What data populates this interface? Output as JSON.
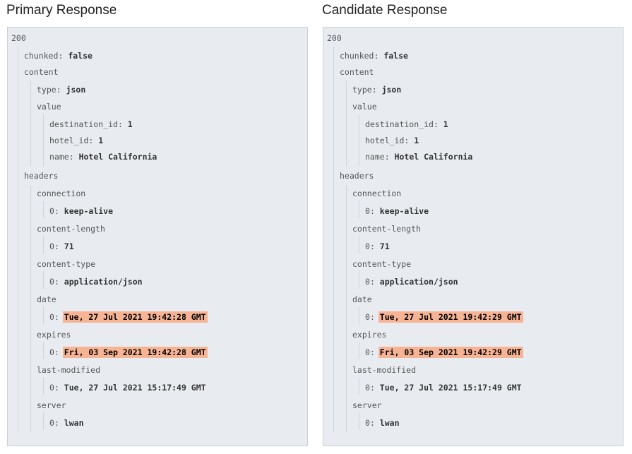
{
  "panels": [
    {
      "title": "Primary Response",
      "status": "200",
      "chunked_key": "chunked",
      "chunked_val": "false",
      "content_key": "content",
      "type_key": "type",
      "type_val": "json",
      "value_key": "value",
      "destination_id_key": "destination_id",
      "destination_id_val": "1",
      "hotel_id_key": "hotel_id",
      "hotel_id_val": "1",
      "name_key": "name",
      "name_val": "Hotel California",
      "headers_key": "headers",
      "headers": [
        {
          "key": "connection",
          "idx": "0",
          "val": "keep-alive",
          "diff": false
        },
        {
          "key": "content-length",
          "idx": "0",
          "val": "71",
          "diff": false
        },
        {
          "key": "content-type",
          "idx": "0",
          "val": "application/json",
          "diff": false
        },
        {
          "key": "date",
          "idx": "0",
          "val": "Tue, 27 Jul 2021 19:42:28 GMT",
          "diff": true
        },
        {
          "key": "expires",
          "idx": "0",
          "val": "Fri, 03 Sep 2021 19:42:28 GMT",
          "diff": true
        },
        {
          "key": "last-modified",
          "idx": "0",
          "val": "Tue, 27 Jul 2021 15:17:49 GMT",
          "diff": false
        },
        {
          "key": "server",
          "idx": "0",
          "val": "lwan",
          "diff": false
        }
      ]
    },
    {
      "title": "Candidate Response",
      "status": "200",
      "chunked_key": "chunked",
      "chunked_val": "false",
      "content_key": "content",
      "type_key": "type",
      "type_val": "json",
      "value_key": "value",
      "destination_id_key": "destination_id",
      "destination_id_val": "1",
      "hotel_id_key": "hotel_id",
      "hotel_id_val": "1",
      "name_key": "name",
      "name_val": "Hotel California",
      "headers_key": "headers",
      "headers": [
        {
          "key": "connection",
          "idx": "0",
          "val": "keep-alive",
          "diff": false
        },
        {
          "key": "content-length",
          "idx": "0",
          "val": "71",
          "diff": false
        },
        {
          "key": "content-type",
          "idx": "0",
          "val": "application/json",
          "diff": false
        },
        {
          "key": "date",
          "idx": "0",
          "val": "Tue, 27 Jul 2021 19:42:29 GMT",
          "diff": true
        },
        {
          "key": "expires",
          "idx": "0",
          "val": "Fri, 03 Sep 2021 19:42:29 GMT",
          "diff": true
        },
        {
          "key": "last-modified",
          "idx": "0",
          "val": "Tue, 27 Jul 2021 15:17:49 GMT",
          "diff": false
        },
        {
          "key": "server",
          "idx": "0",
          "val": "lwan",
          "diff": false
        }
      ]
    }
  ],
  "colors": {
    "diff_highlight": "#f7b494",
    "panel_bg": "#e8ecf1"
  }
}
